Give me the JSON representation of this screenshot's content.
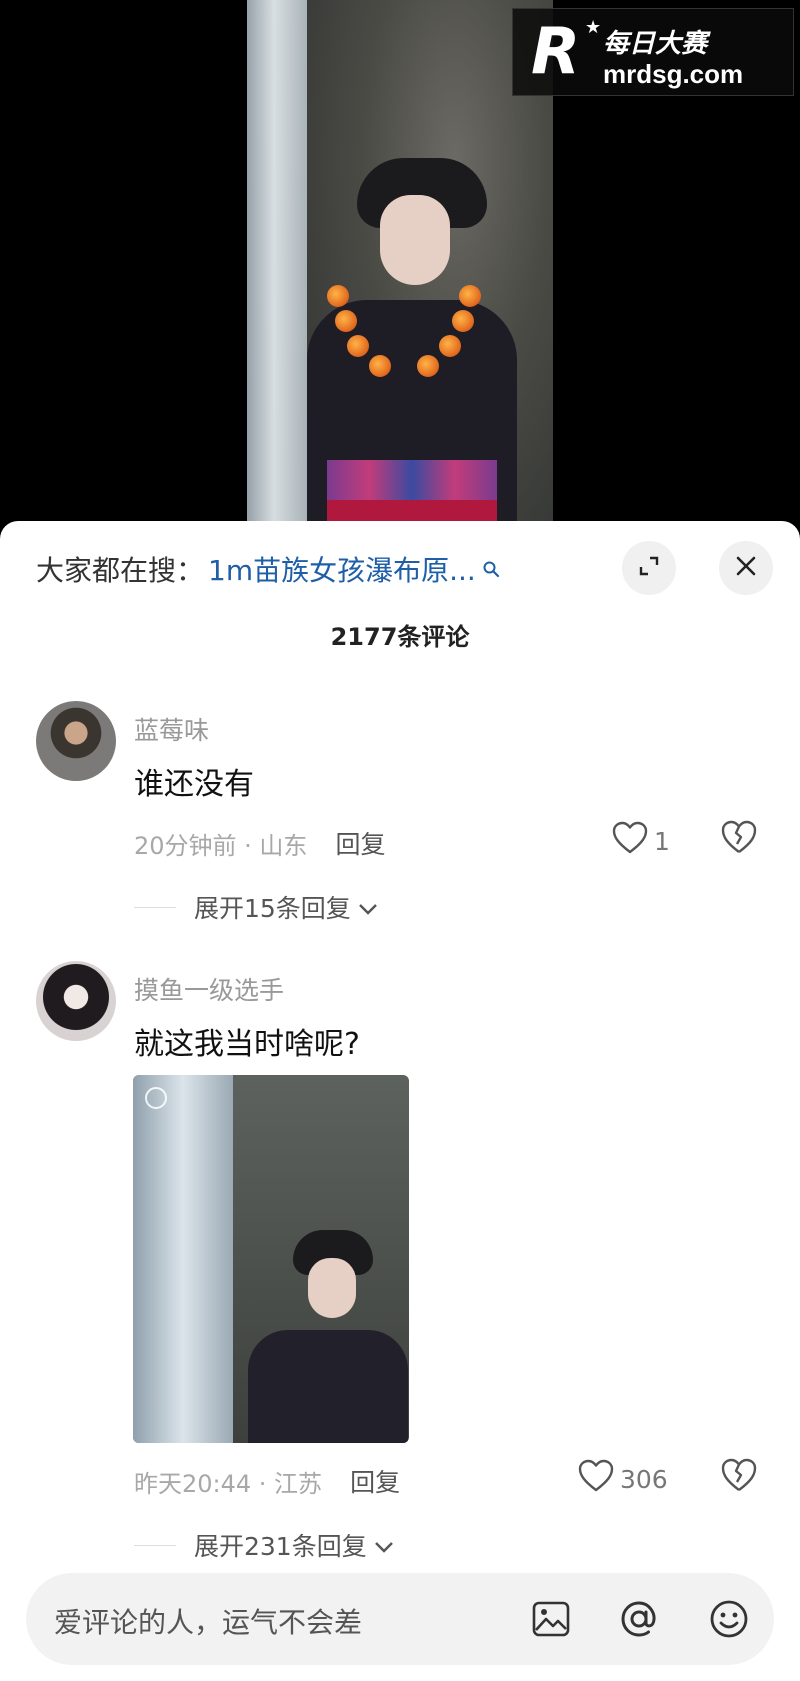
{
  "watermark": {
    "logo_letter": "R",
    "brand": "每日大赛",
    "url": "mrdsg.com"
  },
  "header": {
    "search_label": "大家都在搜：",
    "search_term": "1m苗族女孩瀑布原...",
    "comment_count": "2177条评论"
  },
  "comments": [
    {
      "username": "蓝莓味",
      "text": "谁还没有",
      "time_location": "20分钟前 · 山东",
      "reply_label": "回复",
      "likes": "1",
      "expand_label": "展开15条回复"
    },
    {
      "username": "摸鱼一级选手",
      "text": "就这我当时啥呢?",
      "time_location": "昨天20:44 · 江苏",
      "reply_label": "回复",
      "likes": "306",
      "expand_label": "展开231条回复"
    }
  ],
  "input": {
    "placeholder": "爱评论的人，运气不会差"
  },
  "icons": {
    "search": "search-icon",
    "expand": "expand-icon",
    "close": "close-icon",
    "like": "heart-icon",
    "dislike": "broken-heart-icon",
    "image": "image-icon",
    "mention": "at-icon",
    "emoji": "emoji-icon"
  },
  "colors": {
    "accent_link": "#1f5fa8",
    "sheet_background": "#ffffff",
    "video_background": "#000000"
  }
}
